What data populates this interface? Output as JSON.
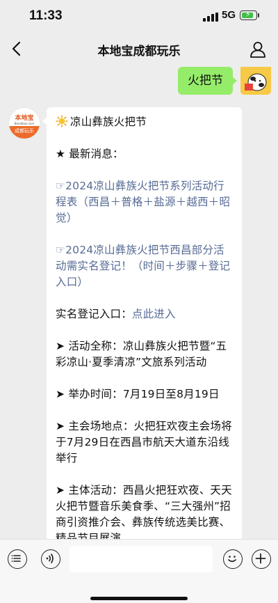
{
  "status": {
    "time": "11:33",
    "network": "5G"
  },
  "nav": {
    "title": "本地宝成都玩乐"
  },
  "me": {
    "message": "火把节"
  },
  "bot": {
    "avatar_brand": "本地宝",
    "avatar_domain": "Bendibao.com",
    "avatar_sub": "成都玩乐",
    "title": "凉山彝族火把节",
    "news_heading": "★ 最新消息：",
    "link1": "☞2024凉山彝族火把节系列活动行程表（西昌＋普格＋盐源＋越西＋昭觉）",
    "link2": "☞2024凉山彝族火把节西昌部分活动需实名登记！（时间＋步骤＋登记入口）",
    "register_label": "实名登记入口：",
    "register_link": "点此进入",
    "full_name": "➤ 活动全称：凉山彝族火把节暨“五彩凉山·夏季清凉”文旅系列活动",
    "time": "➤ 举办时间：7月19日至8月19日",
    "venue": "➤ 主会场地点：火把狂欢夜主会场将于7月29日在西昌市航天大道东沿线举行",
    "main_events": "➤ 主体活动：西昌火把狂欢夜、天天火把节暨音乐美食季、“三大强州”招商引资推介会、彝族传统选美比赛、精品节目展演"
  }
}
